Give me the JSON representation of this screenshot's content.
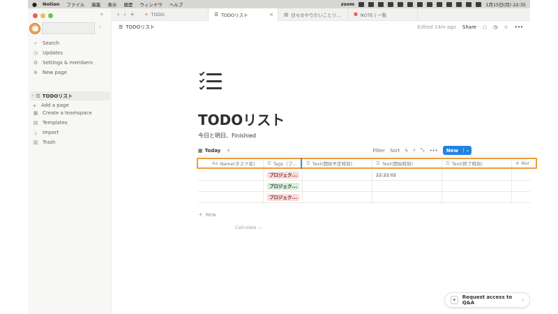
{
  "menubar": {
    "app": "Notion",
    "menus": [
      "ファイル",
      "編集",
      "表示",
      "履歴",
      "ウィンドウ",
      "ヘルプ"
    ],
    "zoom_label": "zoom",
    "clock": "1月15日(月)  22:35"
  },
  "sidebar": {
    "items": [
      {
        "label": "Search",
        "icon": "search-icon"
      },
      {
        "label": "Updates",
        "icon": "clock-icon"
      },
      {
        "label": "Settings & members",
        "icon": "gear-icon"
      },
      {
        "label": "New page",
        "icon": "plus-circle-icon"
      }
    ],
    "page_label": "TODOリスト",
    "add_page_label": "Add a page",
    "tools": [
      {
        "label": "Create a teamspace",
        "icon": "teamspace-icon"
      },
      {
        "label": "Templates",
        "icon": "templates-icon"
      },
      {
        "label": "Import",
        "icon": "import-icon"
      },
      {
        "label": "Trash",
        "icon": "trash-icon"
      }
    ]
  },
  "tabs": [
    {
      "label": "TODO",
      "active": false
    },
    {
      "label": "TODOリスト",
      "active": true
    },
    {
      "label": "日々のやりだいことリ...",
      "active": false
    },
    {
      "label": "NOTE | 一覧",
      "active": false
    }
  ],
  "topbar": {
    "breadcrumb": "TODOリスト",
    "edited": "Edited 14m ago",
    "share": "Share"
  },
  "page": {
    "title": "TODOリスト",
    "description": "今日と明日、Finishied"
  },
  "database": {
    "view_tab": "Today",
    "toolbar": {
      "filter": "Filter",
      "sort": "Sort",
      "new": "New"
    },
    "columns": [
      {
        "label": "Name(タスク名)",
        "icon": "Aa"
      },
      {
        "label": "Tags（プ...",
        "icon": "☰"
      },
      {
        "label": "Text(開始予定時刻)",
        "icon": "☰"
      },
      {
        "label": "Text(開始時刻)",
        "icon": "☰"
      },
      {
        "label": "Text(終了時刻)",
        "icon": "☰"
      },
      {
        "label": "Nur",
        "icon": "#"
      }
    ],
    "rows": [
      {
        "name": "",
        "tag": "プロジェク...",
        "tag_color": "#fbdada",
        "planned": "",
        "start": "22:22:02",
        "end": ""
      },
      {
        "name": "",
        "tag": "プロジェク...",
        "tag_color": "#dbeddb",
        "planned": "",
        "start": "",
        "end": ""
      },
      {
        "name": "",
        "tag": "プロジェク...",
        "tag_color": "#fbdada",
        "planned": "",
        "start": "",
        "end": ""
      }
    ],
    "new_row": "New",
    "calculate": "Calculate"
  },
  "qa_button": "Request access to Q&A"
}
